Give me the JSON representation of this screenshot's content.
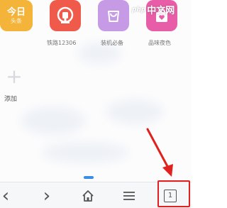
{
  "apps": {
    "today": {
      "line1": "今日",
      "line2": "头条"
    },
    "railway": {
      "label": "铁路12306"
    },
    "phone_essentials": {
      "label": "装机必备"
    },
    "quality_night": {
      "label": "品味夜色"
    }
  },
  "add_tile": {
    "label": "添加"
  },
  "watermark": {
    "prefix": "php",
    "text": "中文网"
  },
  "bottom_bar": {
    "back_glyph": "‹",
    "forward_glyph": "›",
    "tabs_count": "1"
  },
  "colors": {
    "today": "#f4b43a",
    "railway": "#f05a4a",
    "phone_essentials": "#c79ae6",
    "quality_night": "#e85da7",
    "highlight": "#e0211f",
    "indicator": "#3a8ee6"
  },
  "icons": {
    "railway": "train-logo-icon",
    "phone_essentials": "shopping-bag-icon",
    "quality_night": "hearts-bag-icon",
    "home": "home-icon",
    "menu": "hamburger-menu-icon",
    "tabs": "tabs-window-icon"
  }
}
